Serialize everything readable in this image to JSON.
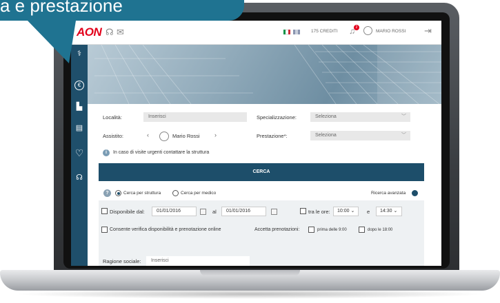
{
  "callout": {
    "text": "a e prestazione"
  },
  "header": {
    "logo": "AON",
    "credits": "175 CREDITI",
    "notifications_count": "2",
    "user_name": "MARIO ROSSI",
    "flag_colors": [
      "#009246",
      "#ffffff",
      "#ce2b37"
    ]
  },
  "sidebar": {
    "items": [
      {
        "icon": "stethoscope-icon",
        "glyph": "⚕"
      },
      {
        "icon": "euro-icon",
        "glyph": "€"
      },
      {
        "icon": "chart-icon",
        "glyph": "▙"
      },
      {
        "icon": "document-icon",
        "glyph": "▤"
      },
      {
        "icon": "heart-icon",
        "glyph": "♡"
      },
      {
        "icon": "headset-icon",
        "glyph": "☊"
      }
    ]
  },
  "search": {
    "localita_label": "Località:",
    "localita_placeholder": "Inserisci",
    "specializzazione_label": "Specializzazione:",
    "specializzazione_value": "Seleziona",
    "assistito_label": "Assistito:",
    "assistito_name": "Mario Rossi",
    "prestazione_label": "Prestazione*:",
    "prestazione_value": "Seleziona",
    "info_text": "In caso di visite urgenti contattare la struttura",
    "cerca_label": "CERCA",
    "radio_struttura": "Cerca per struttura",
    "radio_medico": "Cerca per medico",
    "ricerca_avanzata": "Ricerca avanzata"
  },
  "filters": {
    "disponibile_label": "Disponibile dal:",
    "date_from": "01/01/2016",
    "al_label": "al",
    "date_to": "01/01/2016",
    "tra_le_ore_label": "tra le ore:",
    "time_from": "10:00",
    "e_label": "e",
    "time_to": "14:30",
    "verifica_label": "Consente verifica disponibilità e prenotazione online",
    "accetta_label": "Accetta prenotazioni:",
    "prima_label": "prima delle 9:00",
    "dopo_label": "dopo le 18:00",
    "ragione_label": "Ragione sociale:",
    "ragione_placeholder": "Inserisci"
  },
  "colors": {
    "accent": "#1d4e6a",
    "brand": "#e2001a",
    "callout": "#1f7391"
  }
}
